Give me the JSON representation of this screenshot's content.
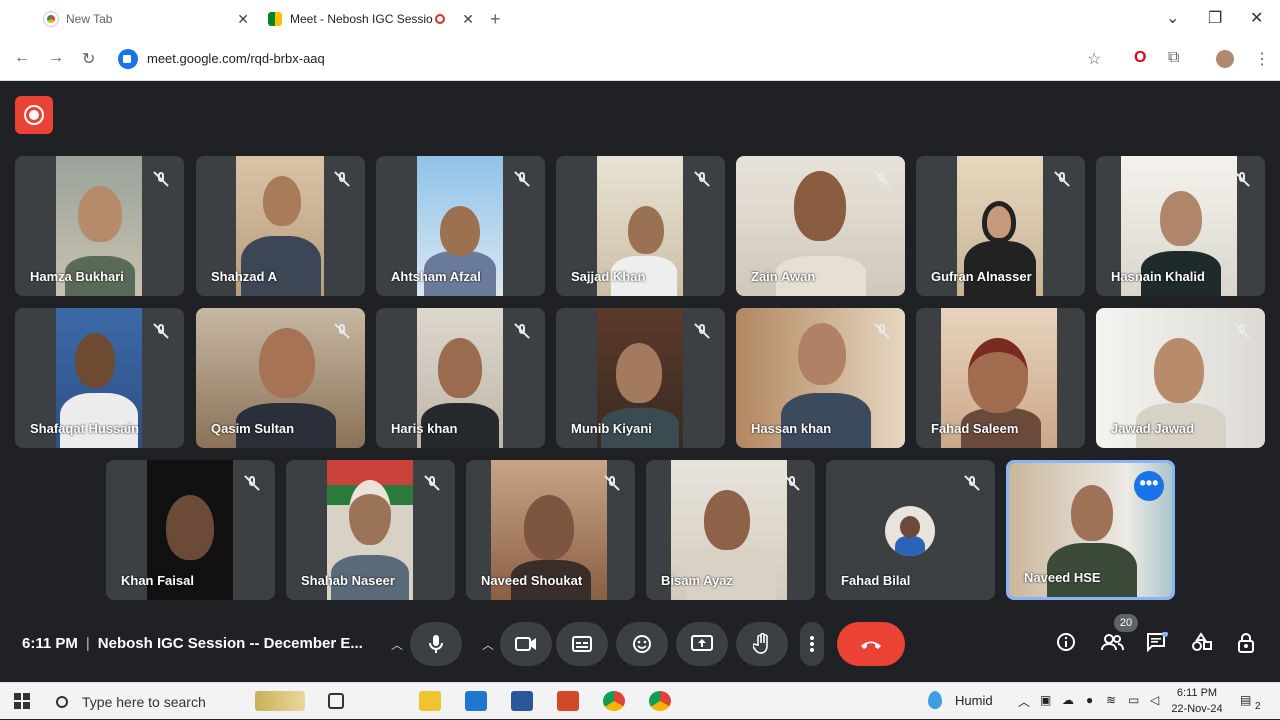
{
  "browser": {
    "tabs": [
      {
        "title": "New Tab",
        "close": "✕"
      },
      {
        "title": "Meet - Nebosh IGC Sessio",
        "close": "✕"
      }
    ],
    "new_tab": "+",
    "window_controls": {
      "minimize": "⌄",
      "restore": "❐",
      "close": "✕"
    },
    "url": "meet.google.com/rqd-brbx-aaq",
    "nav": {
      "back": "←",
      "forward": "→",
      "reload": "↻"
    },
    "toolbar_icons": {
      "bookmark": "☆",
      "opera": "O",
      "extensions": "⧉",
      "menu": "⋮"
    }
  },
  "participants": [
    {
      "name": "Hamza Bukhari",
      "muted": true
    },
    {
      "name": "Shahzad A",
      "muted": true
    },
    {
      "name": "Ahtsham Afzal",
      "muted": true
    },
    {
      "name": "Sajjad Khan",
      "muted": true
    },
    {
      "name": "Zain Awan",
      "muted": true
    },
    {
      "name": "Gufran Alnasser",
      "muted": true
    },
    {
      "name": "Hasnain Khalid",
      "muted": true
    },
    {
      "name": "Shafaqat Hussain",
      "muted": true
    },
    {
      "name": "Qasim Sultan",
      "muted": true
    },
    {
      "name": "Haris khan",
      "muted": true
    },
    {
      "name": "Munib Kiyani",
      "muted": true
    },
    {
      "name": "Hassan khan",
      "muted": true
    },
    {
      "name": "Fahad Saleem",
      "muted": false
    },
    {
      "name": "Jawad Jawad",
      "muted": true
    },
    {
      "name": "Khan Faisal",
      "muted": true
    },
    {
      "name": "Shahab Naseer",
      "muted": true
    },
    {
      "name": "Naveed Shoukat",
      "muted": true
    },
    {
      "name": "Bisam Ayaz",
      "muted": true
    },
    {
      "name": "Fahad Bilal",
      "muted": true
    },
    {
      "name": "Naveed HSE",
      "muted": false
    }
  ],
  "more_options": "•••",
  "meeting": {
    "time": "6:11 PM",
    "separator": "|",
    "title": "Nebosh IGC Session -- December E..."
  },
  "controls": {
    "chevron": "︿",
    "participants_count": "20"
  },
  "taskbar": {
    "search_placeholder": "Type here to search",
    "weather": "Humid",
    "clock_time": "6:11 PM",
    "clock_date": "22-Nov-24",
    "notification_count": "2"
  }
}
